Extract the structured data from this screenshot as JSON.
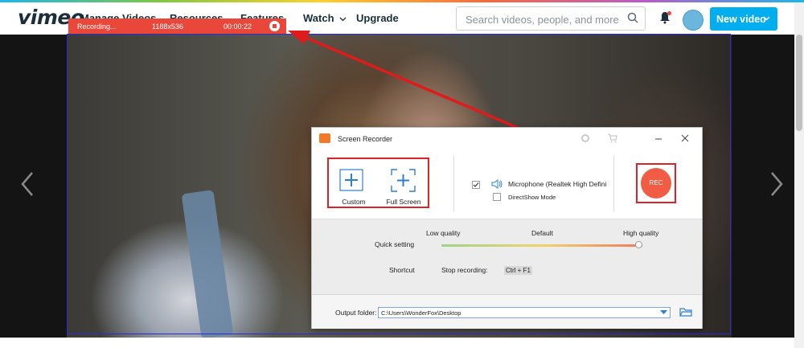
{
  "nav": {
    "logo": "vimeo",
    "items": [
      "Manage Videos",
      "Resources",
      "Features",
      "Watch",
      "Upgrade"
    ],
    "search_placeholder": "Search videos, people, and more",
    "new_video_label": "New video"
  },
  "recording_bar": {
    "status": "Recording...",
    "size": "1188x536",
    "time": "00:00:22"
  },
  "screen_recorder": {
    "title": "Screen Recorder",
    "modes": [
      "Custom",
      "Full Screen"
    ],
    "microphone_label": "Microphone (Realtek High Defini",
    "microphone_checked": true,
    "directshow_label": "DirectShow Mode",
    "directshow_checked": false,
    "rec_label": "REC",
    "quality_low": "Low quality",
    "quality_default": "Default",
    "quality_high": "High quality",
    "quick_setting_label": "Quick setting",
    "quality_level": 1.0,
    "shortcut_label": "Shortcut",
    "stop_recording_label": "Stop recording:",
    "stop_shortcut": "Ctrl + F1",
    "output_folder_label": "Output folder:",
    "output_folder_value": "C:\\Users\\WonderFox\\Desktop"
  },
  "colors": {
    "accent_blue": "#00adef",
    "record_red": "#e8473a",
    "highlight_red": "#d9252a",
    "capture_frame": "#2b2bd8"
  }
}
